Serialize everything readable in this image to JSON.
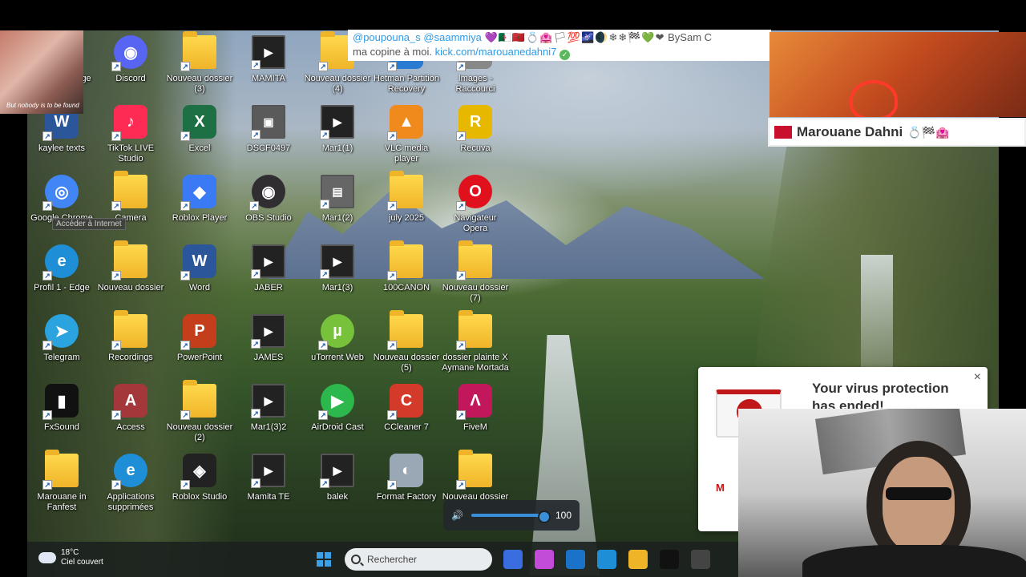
{
  "desktop": {
    "icons": [
      {
        "label": "Microsoft Edge",
        "icon": "edge-icon",
        "color": "#1e8fd6"
      },
      {
        "label": "Discord",
        "icon": "discord-icon",
        "color": "#5865f2"
      },
      {
        "label": "Nouveau dossier (3)",
        "icon": "folder-icon",
        "color": "#f0b429"
      },
      {
        "label": "MAMITA",
        "icon": "video-file-icon",
        "color": "#222222"
      },
      {
        "label": "Nouveau dossier (4)",
        "icon": "folder-icon",
        "color": "#f0b429"
      },
      {
        "label": "Hetman Partition Recovery",
        "icon": "hetman-icon",
        "color": "#2a7bd1"
      },
      {
        "label": "Images - Raccourci",
        "icon": "images-shortcut-icon",
        "color": "#888888"
      },
      {
        "label": "kaylee texts",
        "icon": "word-doc-icon",
        "color": "#2b579a"
      },
      {
        "label": "TikTok LIVE Studio",
        "icon": "tiktok-icon",
        "color": "#fe2c55"
      },
      {
        "label": "Excel",
        "icon": "excel-icon",
        "color": "#1d7044"
      },
      {
        "label": "DSCF0497",
        "icon": "photo-file-icon",
        "color": "#5a5a5a"
      },
      {
        "label": "Mar1(1)",
        "icon": "video-file-icon",
        "color": "#222222"
      },
      {
        "label": "VLC media player",
        "icon": "vlc-icon",
        "color": "#f08a1c"
      },
      {
        "label": "Recuva",
        "icon": "recuva-icon",
        "color": "#e6b800"
      },
      {
        "label": "Google Chrome",
        "icon": "chrome-icon",
        "color": "#4285f4"
      },
      {
        "label": "Camera",
        "icon": "folder-icon",
        "color": "#f0b429"
      },
      {
        "label": "Roblox Player",
        "icon": "roblox-icon",
        "color": "#3a7bf5"
      },
      {
        "label": "OBS Studio",
        "icon": "obs-icon",
        "color": "#302e31"
      },
      {
        "label": "Mar1(2)",
        "icon": "3gp-file-icon",
        "color": "#666666"
      },
      {
        "label": "july 2025",
        "icon": "folder-icon",
        "color": "#f0b429"
      },
      {
        "label": "Navigateur Opera",
        "icon": "opera-icon",
        "color": "#e0111d"
      },
      {
        "label": "Profil 1 - Edge",
        "icon": "edge-profile-icon",
        "color": "#1e8fd6"
      },
      {
        "label": "Nouveau dossier",
        "icon": "folder-icon",
        "color": "#f0b429"
      },
      {
        "label": "Word",
        "icon": "word-icon",
        "color": "#2b579a"
      },
      {
        "label": "JABER",
        "icon": "video-file-icon",
        "color": "#222222"
      },
      {
        "label": "Mar1(3)",
        "icon": "video-file-icon",
        "color": "#222222"
      },
      {
        "label": "100CANON",
        "icon": "folder-icon",
        "color": "#f0b429"
      },
      {
        "label": "Nouveau dossier (7)",
        "icon": "folder-icon",
        "color": "#f0b429"
      },
      {
        "label": "Telegram",
        "icon": "telegram-icon",
        "color": "#2aa3df"
      },
      {
        "label": "Recordings",
        "icon": "folder-icon",
        "color": "#f0b429"
      },
      {
        "label": "PowerPoint",
        "icon": "powerpoint-icon",
        "color": "#c43e1c"
      },
      {
        "label": "JAMES",
        "icon": "video-file-icon",
        "color": "#222222"
      },
      {
        "label": "uTorrent Web",
        "icon": "utorrent-icon",
        "color": "#78c13a"
      },
      {
        "label": "Nouveau dossier (5)",
        "icon": "folder-icon",
        "color": "#f0b429"
      },
      {
        "label": "dossier plainte X Aymane Mortada",
        "icon": "folder-icon",
        "color": "#f0b429"
      },
      {
        "label": "FxSound",
        "icon": "fxsound-icon",
        "color": "#111111"
      },
      {
        "label": "Access",
        "icon": "access-icon",
        "color": "#a4373a"
      },
      {
        "label": "Nouveau dossier (2)",
        "icon": "folder-icon",
        "color": "#f0b429"
      },
      {
        "label": "Mar1(3)2",
        "icon": "video-file-icon",
        "color": "#222222"
      },
      {
        "label": "AirDroid Cast",
        "icon": "airdroid-icon",
        "color": "#2db84d"
      },
      {
        "label": "CCleaner 7",
        "icon": "ccleaner-icon",
        "color": "#d43a2a"
      },
      {
        "label": "FiveM",
        "icon": "fivem-icon",
        "color": "#c2185b"
      },
      {
        "label": "Marouane in Fanfest",
        "icon": "folder-icon",
        "color": "#f0b429"
      },
      {
        "label": "Applications supprimées",
        "icon": "edge-icon",
        "color": "#1e8fd6"
      },
      {
        "label": "Roblox Studio",
        "icon": "roblox-studio-icon",
        "color": "#222222"
      },
      {
        "label": "Mamita TE",
        "icon": "video-file-icon",
        "color": "#222222"
      },
      {
        "label": "balek",
        "icon": "video-file-icon",
        "color": "#222222"
      },
      {
        "label": "Format Factory",
        "icon": "format-factory-icon",
        "color": "#9aa7b5"
      },
      {
        "label": "Nouveau dossier",
        "icon": "folder-icon",
        "color": "#f0b429"
      }
    ],
    "tooltip": "Accéder à Internet"
  },
  "taskbar": {
    "weather_temp": "18°C",
    "weather_desc": "Ciel couvert",
    "search_placeholder": "Rechercher",
    "apps": [
      {
        "name": "start-button",
        "icon": "windows-icon",
        "color": "#3aa0e8"
      },
      {
        "name": "app-pinned-1",
        "icon": "visual-studio-icon",
        "color": "#3a6de0"
      },
      {
        "name": "app-pinned-2",
        "icon": "copilot-icon",
        "color": "#c24bd8"
      },
      {
        "name": "app-pinned-3",
        "icon": "outlook-icon",
        "color": "#1a73c8"
      },
      {
        "name": "app-pinned-4",
        "icon": "edge-icon",
        "color": "#1e8fd6"
      },
      {
        "name": "app-pinned-5",
        "icon": "file-explorer-icon",
        "color": "#f0b429"
      },
      {
        "name": "app-pinned-6",
        "icon": "fxsound-icon",
        "color": "#111111"
      },
      {
        "name": "app-pinned-7",
        "icon": "obs-icon",
        "color": "#444444"
      }
    ]
  },
  "volume": {
    "level": "100",
    "fill_fraction": 1.0
  },
  "chat": {
    "user1": "@poupouna_s",
    "user2": "@saammiya",
    "emojis": "💜🇩🇿🇲🇦💍🏩🏳💯🌌🌒❄❄🏁💚❤",
    "by": "BySam C",
    "line2": "ma copine à moi.",
    "link": "kick.com/marouanedahni7",
    "check": "✓"
  },
  "webcam_top": {
    "caption": "But nobody is to be found"
  },
  "streamer": {
    "name": "Marouane Dahni",
    "emojis": "💍🏁🏩"
  },
  "notification": {
    "title": "Your virus protection has ended!",
    "brand": "M",
    "close": "×"
  }
}
